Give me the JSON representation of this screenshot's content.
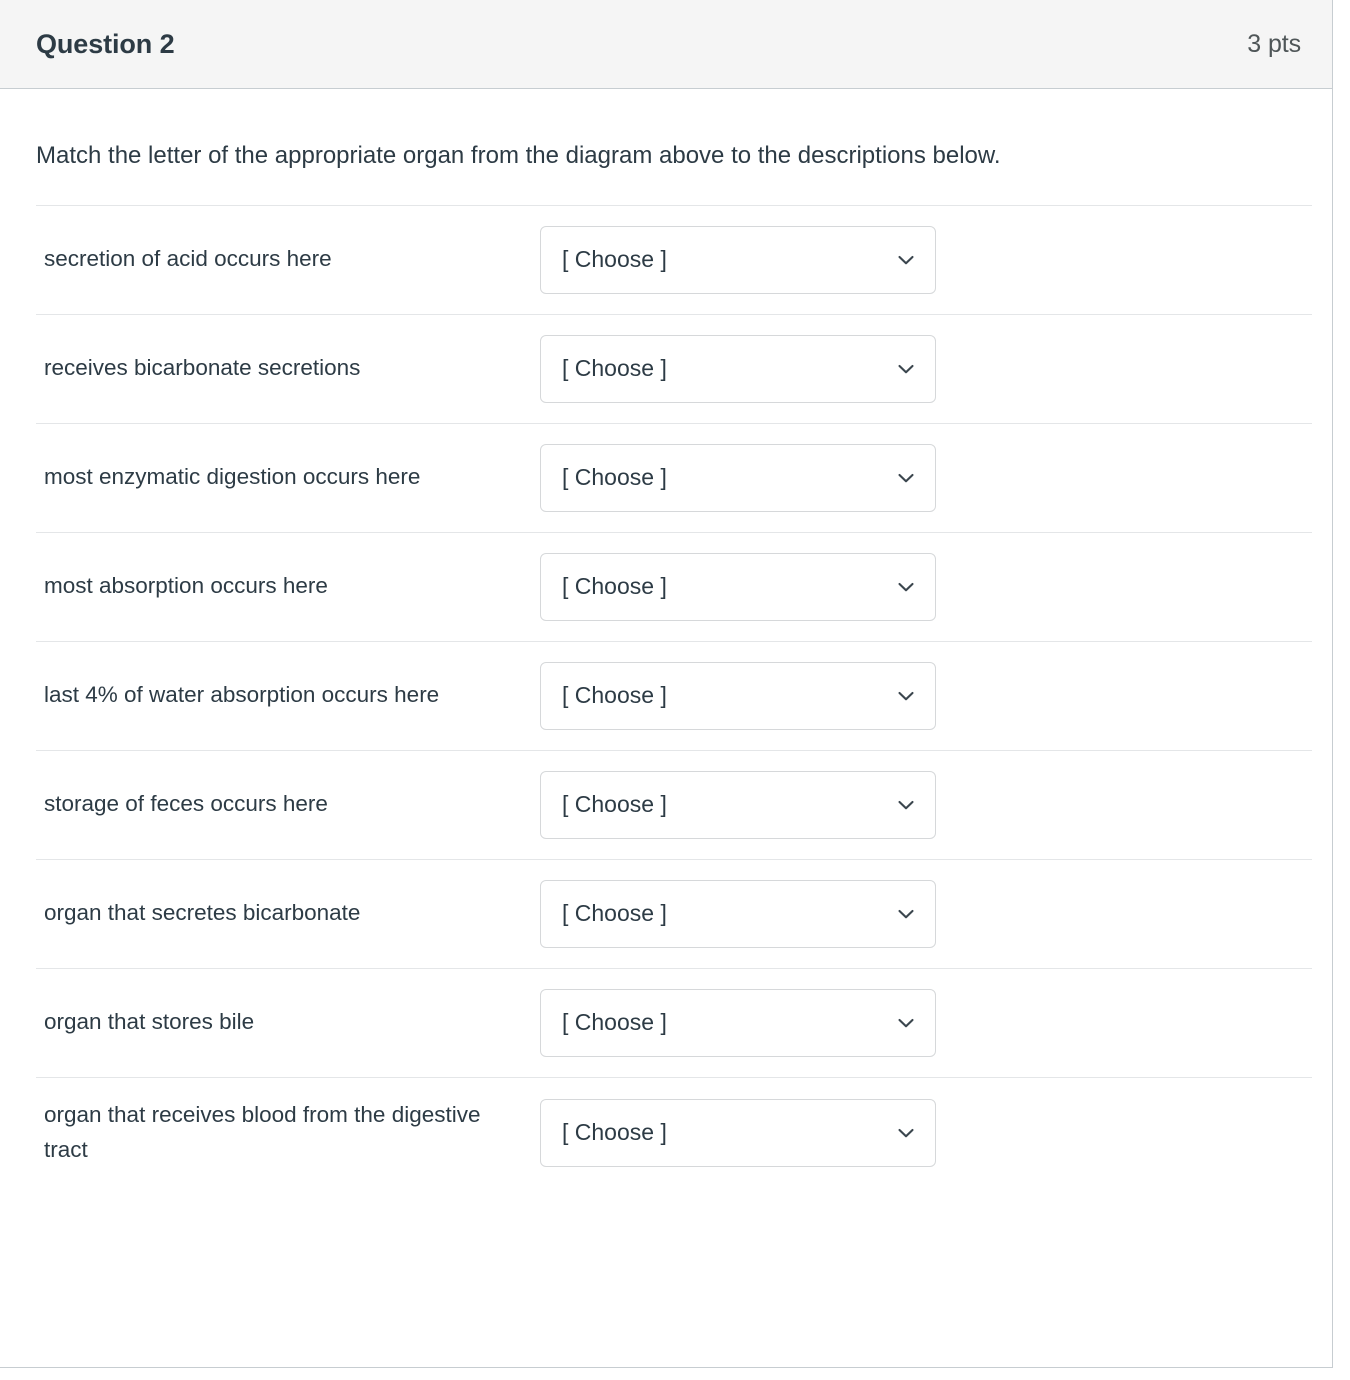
{
  "header": {
    "title": "Question 2",
    "points": "3 pts"
  },
  "body": {
    "prompt": "Match the letter of the appropriate organ from the diagram above to the descriptions below."
  },
  "colors": {
    "header_background": "#f5f5f5",
    "header_border": "#c7cdd1",
    "text_primary": "#2d3b45",
    "points_text": "#4f5658",
    "row_divider": "#e4e6e8",
    "select_border": "#d6d8da"
  },
  "select_placeholder": "[ Choose ]",
  "matches": [
    {
      "label": "secretion of acid occurs here",
      "value": "[ Choose ]"
    },
    {
      "label": "receives bicarbonate secretions",
      "value": "[ Choose ]"
    },
    {
      "label": "most enzymatic digestion occurs here",
      "value": "[ Choose ]"
    },
    {
      "label": "most absorption occurs here",
      "value": "[ Choose ]"
    },
    {
      "label": "last 4% of water absorption occurs here",
      "value": "[ Choose ]"
    },
    {
      "label": "storage of feces occurs here",
      "value": "[ Choose ]"
    },
    {
      "label": "organ that secretes bicarbonate",
      "value": "[ Choose ]"
    },
    {
      "label": "organ that stores bile",
      "value": "[ Choose ]"
    },
    {
      "label": "organ that receives blood from the digestive tract",
      "value": "[ Choose ]"
    }
  ]
}
